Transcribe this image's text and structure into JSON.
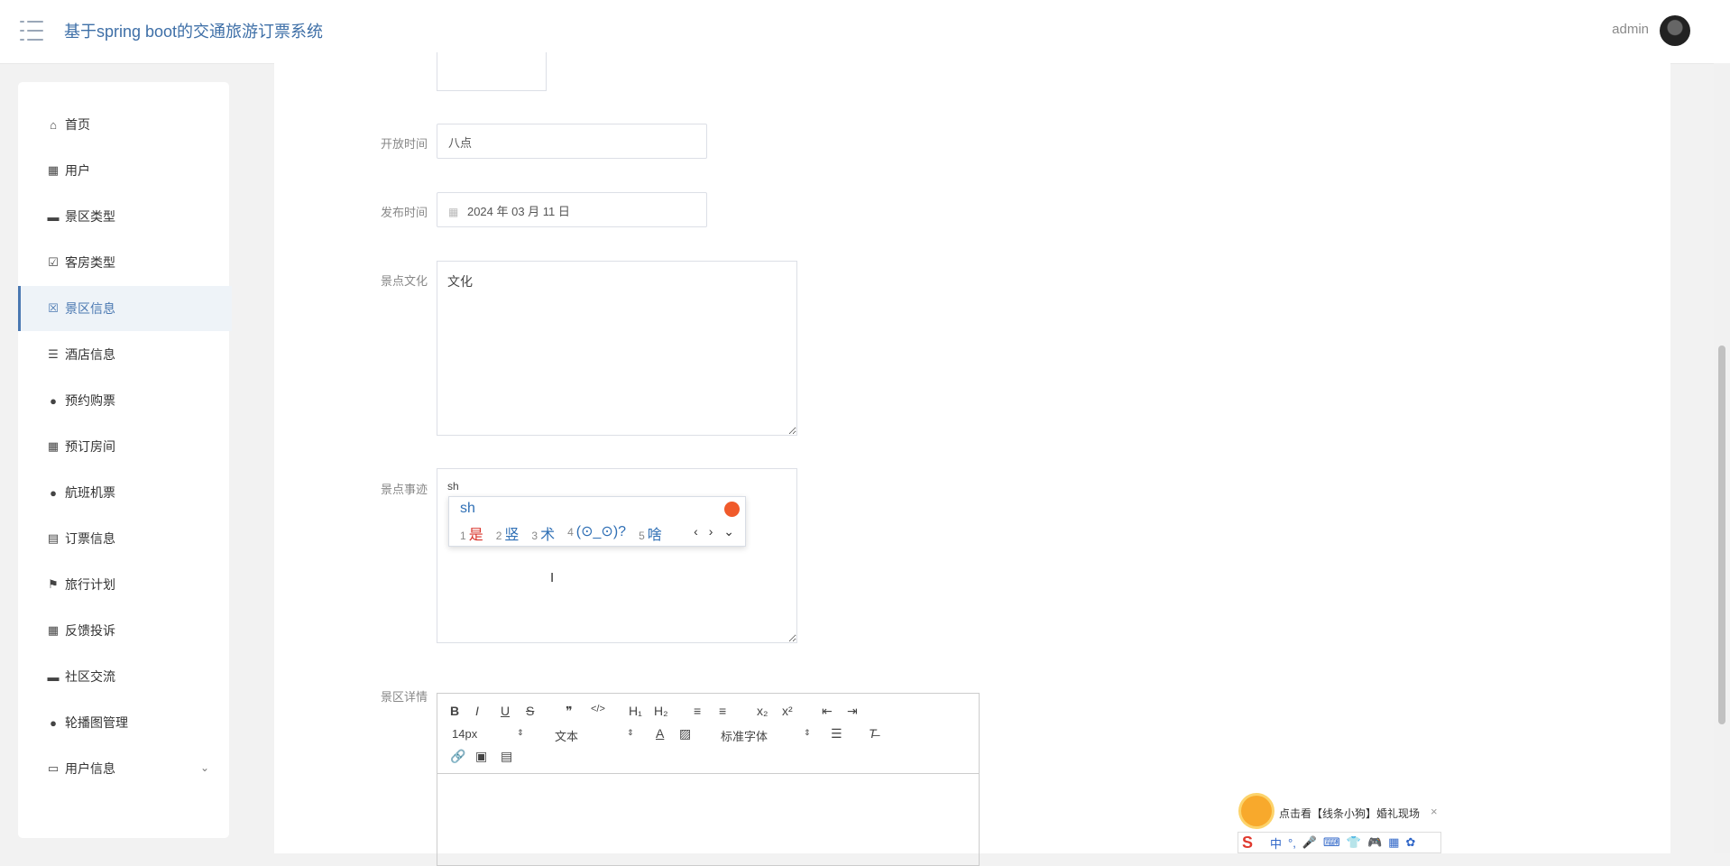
{
  "header": {
    "title": "基于spring boot的交通旅游订票系统",
    "username": "admin"
  },
  "sidebar": {
    "items": [
      {
        "label": "首页",
        "icon": "home-icon"
      },
      {
        "label": "用户",
        "icon": "grid-icon"
      },
      {
        "label": "景区类型",
        "icon": "chat-icon"
      },
      {
        "label": "客房类型",
        "icon": "clipboard-check-icon"
      },
      {
        "label": "景区信息",
        "icon": "clipboard-x-icon"
      },
      {
        "label": "酒店信息",
        "icon": "sliders-icon"
      },
      {
        "label": "预约购票",
        "icon": "user-icon"
      },
      {
        "label": "预订房间",
        "icon": "grid-icon"
      },
      {
        "label": "航班机票",
        "icon": "person-icon"
      },
      {
        "label": "订票信息",
        "icon": "clipboard-icon"
      },
      {
        "label": "旅行计划",
        "icon": "flag-icon"
      },
      {
        "label": "反馈投诉",
        "icon": "grid-icon"
      },
      {
        "label": "社区交流",
        "icon": "sign-icon"
      },
      {
        "label": "轮播图管理",
        "icon": "bulb-icon"
      },
      {
        "label": "用户信息",
        "icon": "card-icon"
      }
    ],
    "active": "景区信息"
  },
  "form": {
    "open_time": {
      "label": "开放时间",
      "value": "八点"
    },
    "publish_time": {
      "label": "发布时间",
      "value": "2024 年 03 月 11 日"
    },
    "culture": {
      "label": "景点文化",
      "value": "文化"
    },
    "deeds": {
      "label": "景点事迹",
      "value": "sh"
    },
    "detail": {
      "label": "景区详情"
    }
  },
  "ime": {
    "typed": "sh",
    "candidates": [
      {
        "n": "1",
        "text": "是"
      },
      {
        "n": "2",
        "text": "竖"
      },
      {
        "n": "3",
        "text": "术"
      },
      {
        "n": "4",
        "text": "(⊙_⊙)?"
      },
      {
        "n": "5",
        "text": "啥"
      }
    ],
    "nav": "‹ › ⌄"
  },
  "editor": {
    "font_size": "14px",
    "paragraph": "文本",
    "font_family": "标准字体",
    "buttons_row1": [
      "B",
      "I",
      "U",
      "S",
      "❞",
      "</>",
      "H₁",
      "H₂",
      "≡",
      "≡",
      "x₂",
      "x²",
      "⇤",
      "⇥"
    ]
  },
  "promo": {
    "text": "点击看【线条小狗】婚礼现场",
    "close": "×",
    "ime_bar": [
      "中",
      "°,",
      "🎤",
      "⌨",
      "👕",
      "🎮",
      "▦",
      "✿"
    ]
  }
}
